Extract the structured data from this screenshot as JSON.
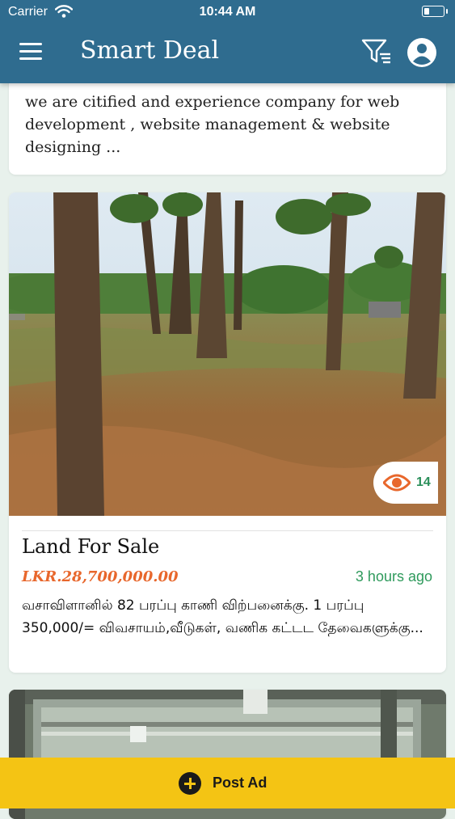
{
  "status_bar": {
    "carrier": "Carrier",
    "time": "10:44 AM"
  },
  "app_bar": {
    "title": "Smart Deal"
  },
  "listings": [
    {
      "description": "we are citified and experience company for web development , website management & website designing ..."
    },
    {
      "title": "Land For Sale",
      "price": "LKR.28,700,000.00",
      "time_ago": "3 hours ago",
      "views": "14",
      "description": "வசாவிளானில் 82 பரப்பு காணி விற்பனைக்கு. 1 பரப்பு 350,000/= விவசாயம்,வீடுகள், வணிக கட்டட தேவைகளுக்கு..."
    },
    {}
  ],
  "post_ad": {
    "label": "Post Ad"
  },
  "colors": {
    "header": "#2f6c8f",
    "background": "#e8f1ec",
    "price": "#e8672c",
    "time_ago": "#2f9a5c",
    "post_bar": "#f4c414"
  },
  "icons": [
    "menu-icon",
    "filter-icon",
    "account-icon",
    "eye-icon",
    "plus-circle-icon",
    "wifi-icon",
    "battery-icon"
  ]
}
